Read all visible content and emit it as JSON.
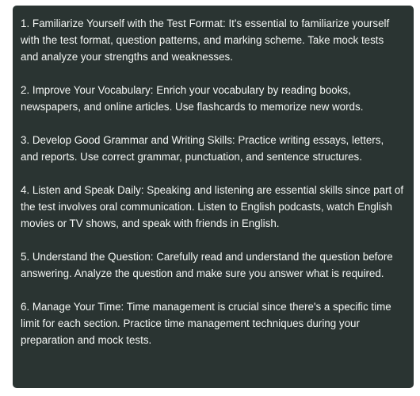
{
  "message": {
    "tips": [
      "1. Familiarize Yourself with the Test Format: It's essential to familiarize yourself with the test format, question patterns, and marking scheme. Take mock tests and analyze your strengths and weaknesses.",
      "2. Improve Your Vocabulary: Enrich your vocabulary by reading books, newspapers, and online articles. Use flashcards to memorize new words.",
      "3. Develop Good Grammar and Writing Skills: Practice writing essays, letters, and reports. Use correct grammar, punctuation, and sentence structures.",
      "4. Listen and Speak Daily: Speaking and listening are essential skills since part of the test involves oral communication. Listen to English podcasts, watch English movies or TV shows, and speak with friends in English.",
      "5. Understand the Question: Carefully read and understand the question before answering. Analyze the question and make sure you answer what is required.",
      "6. Manage Your Time: Time management is crucial since there's a specific time limit for each section. Practice time management techniques during your preparation and mock tests."
    ]
  },
  "colors": {
    "bubble_background": "#2a3432",
    "text": "#f4f6f4",
    "page_background": "#ffffff"
  }
}
